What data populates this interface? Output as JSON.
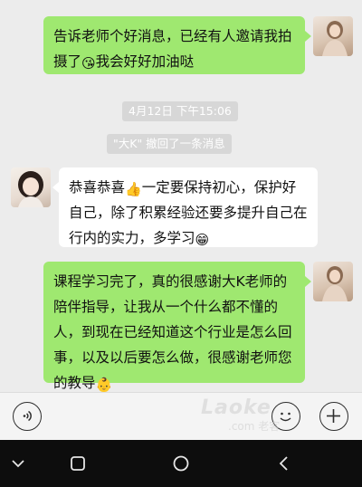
{
  "messages": [
    {
      "side": "right",
      "text_a": "告诉老师个好消息，已经有人邀请我拍摄了",
      "emoji": "😘",
      "text_b": "我会好好加油哒"
    },
    {
      "side": "left",
      "text_a": "恭喜恭喜",
      "emoji": "👍",
      "text_b": "一定要保持初心，保护好自己，除了积累经验还要多提升自己在行内的实力，多学习",
      "emoji2": "😁"
    },
    {
      "side": "right",
      "text_a": "课程学习完了，真的很感谢大K老师的陪伴指导，让我从一个什么都不懂的人，到现在已经知道这个行业是怎么回事，以及以后要怎么做，很感谢老师您的教导",
      "emoji": "👶"
    }
  ],
  "system": {
    "timestamp": "4月12日 下午15:06",
    "recall_notice": "\"大K\" 撤回了一条消息"
  },
  "watermark": {
    "brand": "Laoke",
    "sub": ".com 老客"
  }
}
